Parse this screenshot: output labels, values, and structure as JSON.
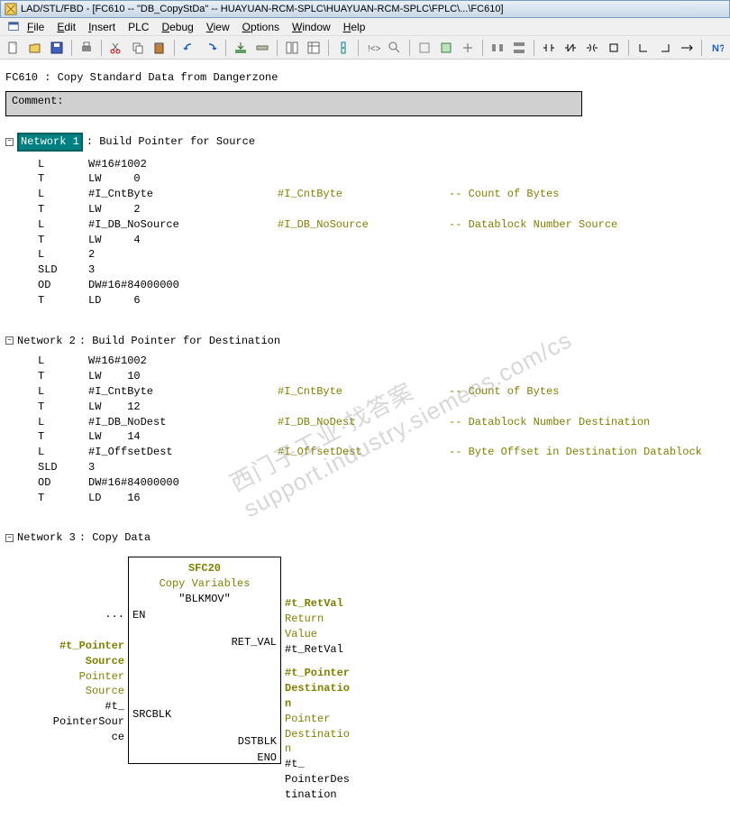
{
  "title": "LAD/STL/FBD  - [FC610 -- \"DB_CopyStDa\" -- HUAYUAN-RCM-SPLC\\HUAYUAN-RCM-SPLC\\FPLC\\...\\FC610]",
  "menu": {
    "file": "File",
    "edit": "Edit",
    "insert": "Insert",
    "plc": "PLC",
    "debug": "Debug",
    "view": "View",
    "options": "Options",
    "window": "Window",
    "help": "Help"
  },
  "header": "FC610 : Copy Standard Data from Dangerzone",
  "comment_label": "Comment:",
  "networks": [
    {
      "id": 1,
      "label": "Network 1",
      "title": ": Build Pointer for Source",
      "highlighted": true,
      "stl": [
        {
          "op": "L",
          "arg": "W#16#1002",
          "sym": "",
          "cmt": ""
        },
        {
          "op": "T",
          "arg": "LW     0",
          "sym": "",
          "cmt": ""
        },
        {
          "op": "L",
          "arg": "#I_CntByte",
          "sym": "#I_CntByte",
          "cmt": "-- Count of Bytes"
        },
        {
          "op": "T",
          "arg": "LW     2",
          "sym": "",
          "cmt": ""
        },
        {
          "op": "L",
          "arg": "#I_DB_NoSource",
          "sym": "#I_DB_NoSource",
          "cmt": "-- Datablock Number Source"
        },
        {
          "op": "T",
          "arg": "LW     4",
          "sym": "",
          "cmt": ""
        },
        {
          "op": "L",
          "arg": "2",
          "sym": "",
          "cmt": ""
        },
        {
          "op": "SLD",
          "arg": "3",
          "sym": "",
          "cmt": ""
        },
        {
          "op": "OD",
          "arg": "DW#16#84000000",
          "sym": "",
          "cmt": ""
        },
        {
          "op": "T",
          "arg": "LD     6",
          "sym": "",
          "cmt": ""
        }
      ]
    },
    {
      "id": 2,
      "label": "Network  2",
      "title": ": Build Pointer for Destination",
      "highlighted": false,
      "stl": [
        {
          "op": "L",
          "arg": "W#16#1002",
          "sym": "",
          "cmt": ""
        },
        {
          "op": "T",
          "arg": "LW    10",
          "sym": "",
          "cmt": ""
        },
        {
          "op": "L",
          "arg": "#I_CntByte",
          "sym": "#I_CntByte",
          "cmt": "-- Count of Bytes"
        },
        {
          "op": "T",
          "arg": "LW    12",
          "sym": "",
          "cmt": ""
        },
        {
          "op": "L",
          "arg": "#I_DB_NoDest",
          "sym": "#I_DB_NoDest",
          "cmt": "-- Datablock Number Destination"
        },
        {
          "op": "T",
          "arg": "LW    14",
          "sym": "",
          "cmt": ""
        },
        {
          "op": "L",
          "arg": "#I_OffsetDest",
          "sym": "#I_OffsetDest",
          "cmt": "-- Byte Offset in Destination Datablock"
        },
        {
          "op": "SLD",
          "arg": "3",
          "sym": "",
          "cmt": ""
        },
        {
          "op": "OD",
          "arg": "DW#16#84000000",
          "sym": "",
          "cmt": ""
        },
        {
          "op": "T",
          "arg": "LD    16",
          "sym": "",
          "cmt": ""
        }
      ]
    },
    {
      "id": 3,
      "label": "Network  3",
      "title": ": Copy Data",
      "highlighted": false
    }
  ],
  "fbd": {
    "block_name": "SFC20",
    "block_desc": "Copy Variables",
    "block_sym": "\"BLKMOV\"",
    "en": "EN",
    "en_signal": "...",
    "srcblk": "SRCBLK",
    "src_var": "#t_PointerSource",
    "src_desc": "Pointer Source",
    "src_tag": "#t_PointerSource",
    "retval": "RET_VAL",
    "ret_var": "#t_RetVal",
    "ret_desc": "Return Value",
    "ret_tag": "#t_RetVal",
    "dstblk": "DSTBLK",
    "dst_var": "#t_PointerDestination",
    "dst_desc": "Pointer Destination",
    "dst_tag": "#t_PointerDestination",
    "eno": "ENO"
  },
  "watermark": "西门子工业·找答案  support.industry.siemens.com/cs"
}
